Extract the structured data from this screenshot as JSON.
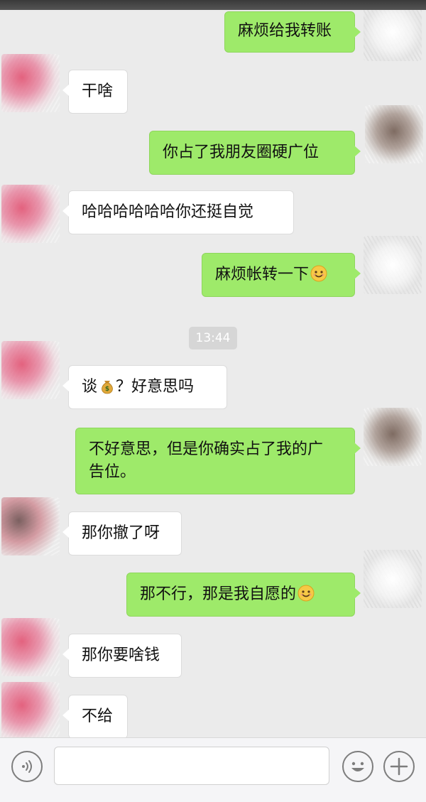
{
  "time_separator": "13:44",
  "messages": [
    {
      "side": "out",
      "text": "麻烦给我转账"
    },
    {
      "side": "in",
      "text": "干啥"
    },
    {
      "side": "out",
      "text": "你占了我朋友圈硬广位"
    },
    {
      "side": "in",
      "text": "哈哈哈哈哈哈你还挺自觉"
    },
    {
      "side": "out",
      "text": "麻烦帐转一下",
      "emoji": "smile-emoji"
    },
    {
      "side": "in",
      "text_before": "谈",
      "emoji": "money-bag-emoji",
      "text_after": "？好意思吗"
    },
    {
      "side": "out",
      "text": "不好意思，但是你确实占了我的广告位。"
    },
    {
      "side": "in",
      "text": "那你撤了呀"
    },
    {
      "side": "out",
      "text": "那不行，那是我自愿的",
      "emoji": "smile-emoji"
    },
    {
      "side": "in",
      "text": "那你要啥钱"
    },
    {
      "side": "in",
      "text": "不给"
    }
  ],
  "input": {
    "value": "",
    "voice_icon": "voice-icon",
    "emoji_icon": "emoji-face-icon",
    "plus_icon": "plus-icon"
  },
  "colors": {
    "sent_bubble": "#9eea6a",
    "received_bubble": "#ffffff",
    "chat_bg": "#ebebeb"
  }
}
